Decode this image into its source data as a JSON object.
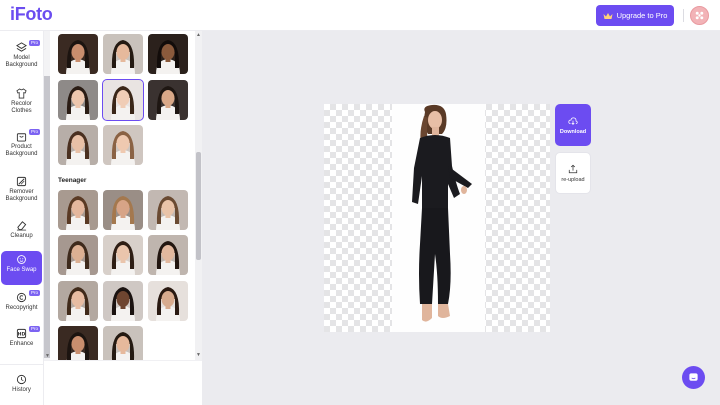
{
  "app": {
    "logo": "iFoto"
  },
  "header": {
    "upgrade_label": "Upgrade to Pro"
  },
  "nav": {
    "items": [
      {
        "label_line1": "Model",
        "label_line2": "Background",
        "pro": "Pro",
        "icon": "layers-icon"
      },
      {
        "label_line1": "Recolor",
        "label_line2": "Clothes",
        "pro": "",
        "icon": "shirt-icon"
      },
      {
        "label_line1": "Product",
        "label_line2": "Background",
        "pro": "Pro",
        "icon": "bag-icon"
      },
      {
        "label_line1": "Remover",
        "label_line2": "Background",
        "pro": "",
        "icon": "slash-square-icon"
      },
      {
        "label_line1": "Cleanup",
        "label_line2": "",
        "pro": "",
        "icon": "eraser-icon"
      },
      {
        "label_line1": "Face Swap",
        "label_line2": "",
        "pro": "",
        "icon": "face-swap-icon",
        "active": true
      },
      {
        "label_line1": "Recopyright",
        "label_line2": "",
        "pro": "Pro",
        "icon": "copyright-icon"
      },
      {
        "label_line1": "Enhance",
        "label_line2": "",
        "pro": "Pro",
        "icon": "enhance-icon"
      }
    ],
    "history_label": "History"
  },
  "panel": {
    "section_teenager": "Teenager",
    "selected_face_index": 4
  },
  "canvas": {
    "download_label": "Download",
    "reupload_label": "re-upload"
  },
  "colors": {
    "accent": "#6c4cf1",
    "canvas_bg": "#ebebef"
  }
}
